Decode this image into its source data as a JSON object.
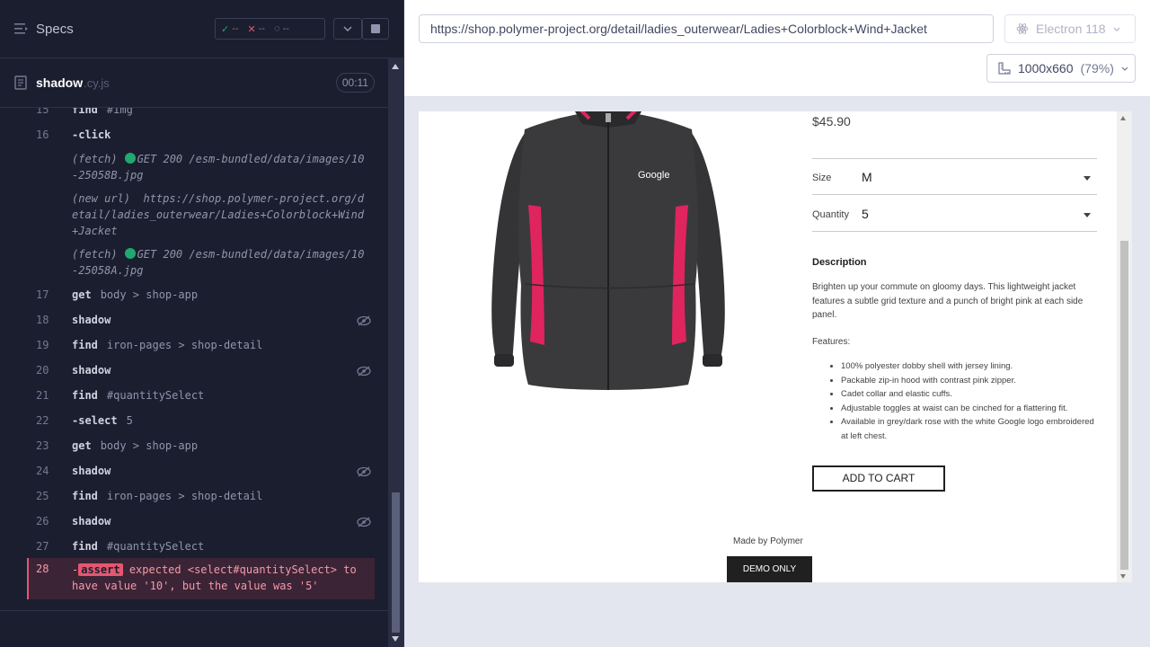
{
  "reporter": {
    "title": "Specs",
    "stats": {
      "passed": "--",
      "failed": "--",
      "pending": "--"
    },
    "spec": {
      "name": "shadow",
      "ext": ".cy.js",
      "duration": "00:11"
    },
    "commands": [
      {
        "num": "15",
        "cmd": "find",
        "msg": "#img",
        "partial": true
      },
      {
        "num": "16",
        "cmd": "-click",
        "msg": ""
      },
      {
        "num": "17",
        "cmd": "get",
        "msg": "body > shop-app"
      },
      {
        "num": "18",
        "cmd": "shadow",
        "msg": ""
      },
      {
        "num": "19",
        "cmd": "find",
        "msg": "iron-pages > shop-detail"
      },
      {
        "num": "20",
        "cmd": "shadow",
        "msg": ""
      },
      {
        "num": "21",
        "cmd": "find",
        "msg": "#quantitySelect"
      },
      {
        "num": "22",
        "cmd": "-select",
        "msg": "5"
      },
      {
        "num": "23",
        "cmd": "get",
        "msg": "body > shop-app"
      },
      {
        "num": "24",
        "cmd": "shadow",
        "msg": ""
      },
      {
        "num": "25",
        "cmd": "find",
        "msg": "iron-pages > shop-detail"
      },
      {
        "num": "26",
        "cmd": "shadow",
        "msg": ""
      },
      {
        "num": "27",
        "cmd": "find",
        "msg": "#quantitySelect"
      }
    ],
    "events": [
      {
        "tag": "(fetch)",
        "text": "GET 200 /esm-bundled/data/images/10-25058B.jpg"
      },
      {
        "tag": "(new url)",
        "text": "https://shop.polymer-project.org/detail/ladies_outerwear/Ladies+Colorblock+Wind+Jacket"
      },
      {
        "tag": "(fetch)",
        "text": "GET 200 /esm-bundled/data/images/10-25058A.jpg"
      }
    ],
    "error": {
      "num": "28",
      "prefix": "-",
      "badge": "assert",
      "text": "expected <select#quantitySelect> to have value '10', but the value was '5'"
    }
  },
  "aut": {
    "url": "https://shop.polymer-project.org/detail/ladies_outerwear/Ladies+Colorblock+Wind+Jacket",
    "browser": "Electron 118",
    "viewport": "1000x660",
    "scale": "(79%)"
  },
  "product": {
    "price": "$45.90",
    "logo_text": "Google",
    "size_label": "Size",
    "size_value": "M",
    "quantity_label": "Quantity",
    "quantity_value": "5",
    "description_heading": "Description",
    "description": "Brighten up your commute on gloomy days. This lightweight jacket features a subtle grid texture and a punch of bright pink at each side panel.",
    "features_heading": "Features:",
    "features": [
      "100% polyester dobby shell with jersey lining.",
      "Packable zip-in hood with contrast pink zipper.",
      "Cadet collar and elastic cuffs.",
      "Adjustable toggles at waist can be cinched for a flattering fit.",
      "Available in grey/dark rose with the white Google logo embroidered at left chest."
    ],
    "add_to_cart": "ADD TO CART",
    "footer_text": "Made by Polymer",
    "demo_label": "DEMO ONLY"
  },
  "colors": {
    "reporter_bg": "#1b1e2e",
    "error_bg": "#3b2436",
    "error_accent": "#e45770",
    "pass_green": "#1fa971",
    "jacket_body": "#3a3a3c",
    "jacket_accent": "#e0245e"
  }
}
